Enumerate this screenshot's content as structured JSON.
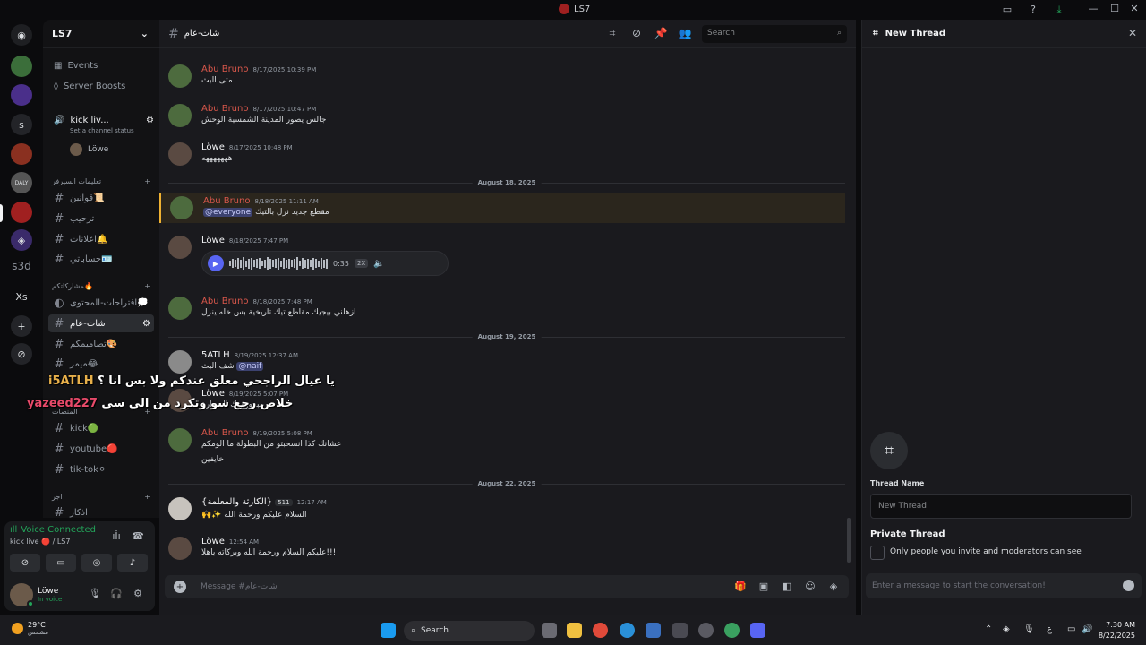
{
  "window": {
    "title": "LS7"
  },
  "server_rail": {
    "items": [
      "discord-home",
      "server-1",
      "server-2",
      "S",
      "server-4",
      "DALY",
      "server-6",
      "twitch",
      "s3d",
      "Xs",
      "add-server",
      "discover"
    ]
  },
  "sidebar": {
    "guild_name": "LS7",
    "events_label": "Events",
    "boosts_label": "Server Boosts",
    "voice_channel": {
      "name": "kick liv...",
      "status": "Set a channel status",
      "user": "Löwe"
    },
    "cat1": "تعليمات السيرفر",
    "cat1_items": [
      "قوانين📜",
      "ترحيب",
      "اعلانات🔔",
      "حساباتي🪪"
    ],
    "cat2": "مشاركاتكم🔥",
    "cat2_items": [
      "اقتراحات-المحتوى💭",
      "شات-عام",
      "تصاميمكم🎨",
      "ميمز😂"
    ],
    "cat3": "المنصات",
    "cat3_items": [
      "kick🟢",
      "youtube🔴",
      "tik-tok⚪"
    ],
    "cat4": "اجر",
    "cat4_items": [
      "اذكار"
    ]
  },
  "voice_panel": {
    "status": "Voice Connected",
    "sub": "kick live 🔴 / LS7"
  },
  "user_panel": {
    "name": "Löwe",
    "status": "In voice"
  },
  "chat": {
    "channel": "شات-عام",
    "search_placeholder": "Search",
    "composer_placeholder": "Message #شات-عام",
    "messages": [
      {
        "user": "Abu Bruno",
        "time": "8/17/2025 10:39 PM",
        "text": "متى البث"
      },
      {
        "user": "Abu Bruno",
        "time": "8/17/2025 10:47 PM",
        "text": "جالس يصور المدينة الشمسية الوحش"
      },
      {
        "user": "Löwe",
        "time": "8/17/2025 10:48 PM",
        "text": "هههههههه"
      },
      {
        "user": "Abu Bruno",
        "time": "8/18/2025 11:11 AM",
        "mention": "@everyone",
        "text": "مقطع جديد نزل بالتيك"
      },
      {
        "user": "Löwe",
        "time": "8/18/2025 7:47 PM",
        "audio_duration": "0:35",
        "audio_speed": "2X"
      },
      {
        "user": "Abu Bruno",
        "time": "8/18/2025 7:48 PM",
        "text": "ازهلني بيجيك مقاطع تيك تاريخية بس خله ينزل"
      },
      {
        "user": "5ATLH",
        "time": "8/19/2025 12:37 AM",
        "text": "شف البث",
        "mention": "@naif"
      },
      {
        "user": "Löwe",
        "time": "8/19/2025 5:07 PM",
        "text": "مبرووووك الصدارة"
      },
      {
        "user": "Abu Bruno",
        "time": "8/19/2025 5:08 PM",
        "text": "عشانك كذا انسحبتو من البطولة ما الومكم",
        "text2": "خايفين"
      },
      {
        "user": "{الكارثة والمعلمة}",
        "badge": "511",
        "time": "12:17 AM",
        "text": "السلام عليكم ورحمة الله",
        "text2": "🙌✨"
      },
      {
        "user": "Löwe",
        "time": "12:54 AM",
        "text": "عليكم السلام ورحمة الله وبركاته ياهلا!!!"
      }
    ],
    "dividers": [
      "August 18, 2025",
      "August 19, 2025",
      "August 22, 2025"
    ],
    "overlay1_user": "i5ATLH",
    "overlay1_text": "يا عيال الراجحي معلق عندكم ولا بس انا ؟",
    "overlay2_user": "yazeed227",
    "overlay2_text": "خلاص رجع سو وتكرد من الي سي"
  },
  "thread": {
    "title": "New Thread",
    "name_label": "Thread Name",
    "name_placeholder": "New Thread",
    "private_label": "Private Thread",
    "private_desc": "Only people you invite and moderators can see",
    "message_placeholder": "Enter a message to start the conversation!"
  },
  "taskbar": {
    "temp": "29°C",
    "weather": "مشمس",
    "search": "Search",
    "lang": "ع",
    "time": "7:30 AM",
    "date": "8/22/2025"
  }
}
